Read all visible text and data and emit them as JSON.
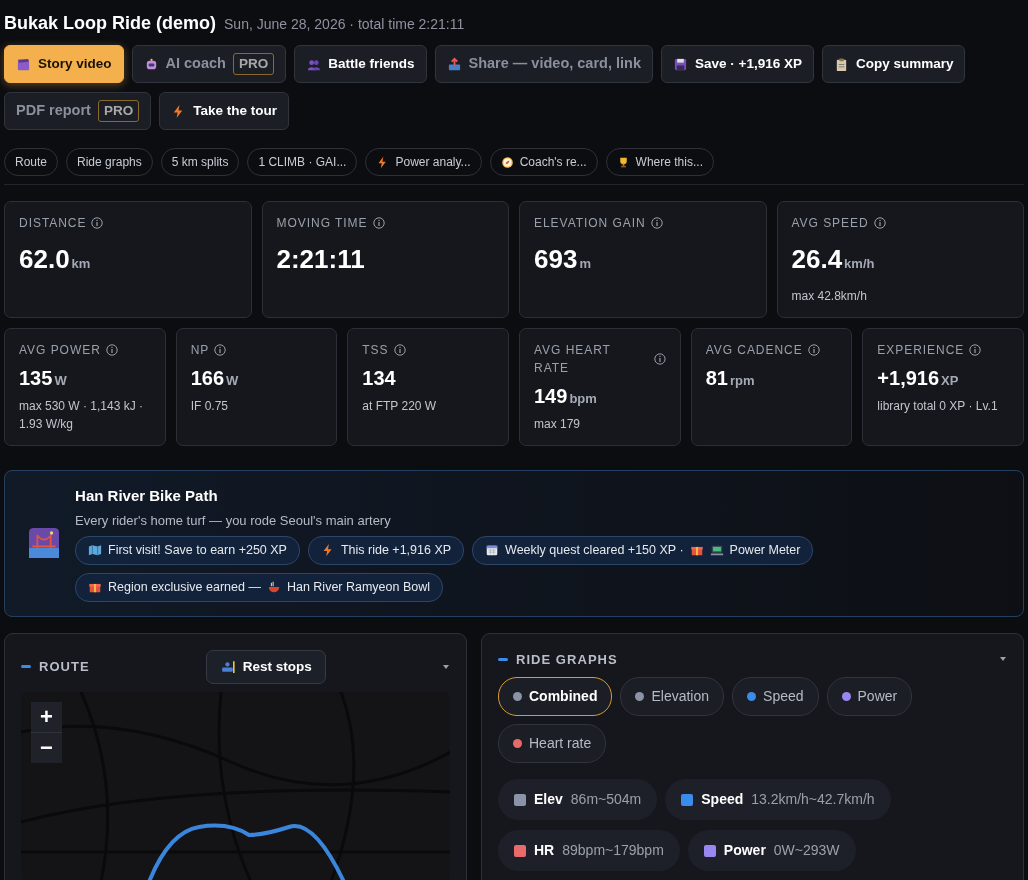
{
  "header": {
    "title": "Bukak Loop Ride (demo)",
    "meta": "Sun, June 28, 2026 · total time 2:21:11"
  },
  "actions": [
    {
      "label": "Story video",
      "kind": "film",
      "highlighted": true,
      "muted": false
    },
    {
      "label": "AI coach",
      "kind": "robot",
      "highlighted": false,
      "muted": true,
      "badge": "PRO"
    },
    {
      "label": "Battle friends",
      "kind": "people",
      "highlighted": false,
      "muted": false
    },
    {
      "label": "Share — video, card, link",
      "kind": "share",
      "highlighted": false,
      "muted": true
    },
    {
      "label": "Save · +1,916 XP",
      "kind": "floppy",
      "highlighted": false,
      "muted": false
    },
    {
      "label": "Copy summary",
      "kind": "clipboard",
      "highlighted": false,
      "muted": false
    },
    {
      "label": "PDF report",
      "kind": "none",
      "highlighted": false,
      "muted": true,
      "badge": "PRO"
    },
    {
      "label": "Take the tour",
      "kind": "bolt",
      "highlighted": false,
      "muted": false
    }
  ],
  "section_tabs": [
    {
      "label": "Route",
      "kind": "none"
    },
    {
      "label": "Ride graphs",
      "kind": "none"
    },
    {
      "label": "5 km splits",
      "kind": "none"
    },
    {
      "label": "1 CLIMB · GAI...",
      "kind": "none"
    },
    {
      "label": "Power analy...",
      "kind": "bolt"
    },
    {
      "label": "Coach's re...",
      "kind": "compass"
    },
    {
      "label": "Where this...",
      "kind": "trophy"
    }
  ],
  "primary_stats": [
    {
      "label": "DISTANCE",
      "value": "62.0",
      "unit": "km"
    },
    {
      "label": "MOVING TIME",
      "value": "2:21:11"
    },
    {
      "label": "ELEVATION GAIN",
      "value": "693",
      "unit": "m"
    },
    {
      "label": "AVG SPEED",
      "value": "26.4",
      "unit": "km/h",
      "sub": "max 42.8km/h"
    }
  ],
  "secondary_stats": [
    {
      "label": "AVG POWER",
      "value": "135",
      "unit": "W",
      "sub": "max 530 W · 1,143 kJ · 1.93 W/kg"
    },
    {
      "label": "NP",
      "value": "166",
      "unit": "W",
      "sub": "IF 0.75"
    },
    {
      "label": "TSS",
      "value": "134",
      "sub": "at FTP 220 W"
    },
    {
      "label": "AVG HEART RATE",
      "value": "149",
      "unit": "bpm",
      "sub": "max 179"
    },
    {
      "label": "AVG CADENCE",
      "value": "81",
      "unit": "rpm"
    },
    {
      "label": "EXPERIENCE",
      "value": "+1,916",
      "unit": "XP",
      "sub": "library total 0 XP · Lv.1"
    }
  ],
  "region": {
    "title": "Han River Bike Path",
    "subtitle": "Every rider's home turf — you rode Seoul's main artery",
    "pills": [
      {
        "parts": [
          {
            "kind": "map"
          },
          {
            "kind": "text",
            "text": "First visit! Save to earn +250 XP"
          }
        ]
      },
      {
        "parts": [
          {
            "kind": "bolt"
          },
          {
            "kind": "text",
            "text": "This ride +1,916 XP"
          }
        ]
      },
      {
        "parts": [
          {
            "kind": "calendar"
          },
          {
            "kind": "text",
            "text": "Weekly quest cleared +150 XP ·"
          },
          {
            "kind": "gift"
          },
          {
            "kind": "computer"
          },
          {
            "kind": "text",
            "text": "Power Meter"
          }
        ]
      },
      {
        "parts": [
          {
            "kind": "gift"
          },
          {
            "kind": "text",
            "text": "Region exclusive earned —"
          },
          {
            "kind": "bowl"
          },
          {
            "kind": "text",
            "text": "Han River Ramyeon Bowl"
          }
        ]
      }
    ]
  },
  "route": {
    "title": "ROUTE",
    "rest_stops": "Rest stops",
    "zoom_in": "+",
    "zoom_out": "−"
  },
  "graphs": {
    "title": "RIDE GRAPHS",
    "modes": [
      {
        "label": "Combined",
        "color": "#8b93a7",
        "selected": true
      },
      {
        "label": "Elevation",
        "color": "#8b93a7",
        "selected": false
      },
      {
        "label": "Speed",
        "color": "#3b8beb",
        "selected": false
      },
      {
        "label": "Power",
        "color": "#9a86f0",
        "selected": false
      },
      {
        "label": "Heart rate",
        "color": "#e86a6a",
        "selected": false
      }
    ],
    "legend": [
      {
        "name": "Elev",
        "range": "86m~504m",
        "color": "#8b93a7"
      },
      {
        "name": "Speed",
        "range": "13.2km/h~42.7km/h",
        "color": "#3b8beb"
      },
      {
        "name": "HR",
        "range": "89bpm~179bpm",
        "color": "#e86a6a"
      },
      {
        "name": "Power",
        "range": "0W~293W",
        "color": "#9a86f0"
      }
    ]
  }
}
